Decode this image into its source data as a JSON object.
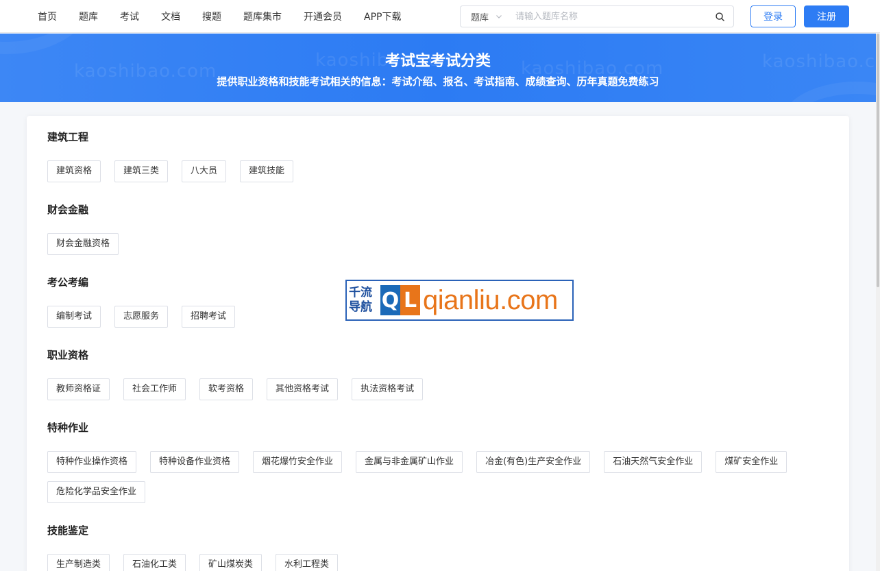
{
  "nav": {
    "items": [
      "首页",
      "题库",
      "考试",
      "文档",
      "搜题",
      "题库集市",
      "开通会员",
      "APP下载"
    ]
  },
  "search": {
    "scope": "题库",
    "placeholder": "请输入题库名称",
    "icon": "search-icon"
  },
  "auth": {
    "login": "登录",
    "register": "注册"
  },
  "banner": {
    "title": "考试宝考试分类",
    "subtitle": "提供职业资格和技能考试相关的信息：考试介绍、报名、考试指南、成绩查询、历年真题免费练习",
    "watermark": "kaoshibao.com"
  },
  "categories": [
    {
      "title": "建筑工程",
      "tags": [
        "建筑资格",
        "建筑三类",
        "八大员",
        "建筑技能"
      ]
    },
    {
      "title": "财会金融",
      "tags": [
        "财会金融资格"
      ]
    },
    {
      "title": "考公考编",
      "tags": [
        "编制考试",
        "志愿服务",
        "招聘考试"
      ]
    },
    {
      "title": "职业资格",
      "tags": [
        "教师资格证",
        "社会工作师",
        "软考资格",
        "其他资格考试",
        "执法资格考试"
      ]
    },
    {
      "title": "特种作业",
      "tags": [
        "特种作业操作资格",
        "特种设备作业资格",
        "烟花爆竹安全作业",
        "金属与非金属矿山作业",
        "冶金(有色)生产安全作业",
        "石油天然气安全作业",
        "煤矿安全作业",
        "危险化学品安全作业"
      ]
    },
    {
      "title": "技能鉴定",
      "tags": [
        "生产制造类",
        "石油化工类",
        "矿山煤炭类",
        "水利工程类"
      ]
    }
  ],
  "overlay_logo": {
    "cn_line1": "千流",
    "cn_line2": "导航",
    "q": "Q",
    "l": "L",
    "domain": "qianliu.com"
  },
  "colors": {
    "primary": "#2d7cf4",
    "banner": "#2c7bf3",
    "logo_blue": "#1b6ab8",
    "logo_orange": "#e8751a"
  }
}
